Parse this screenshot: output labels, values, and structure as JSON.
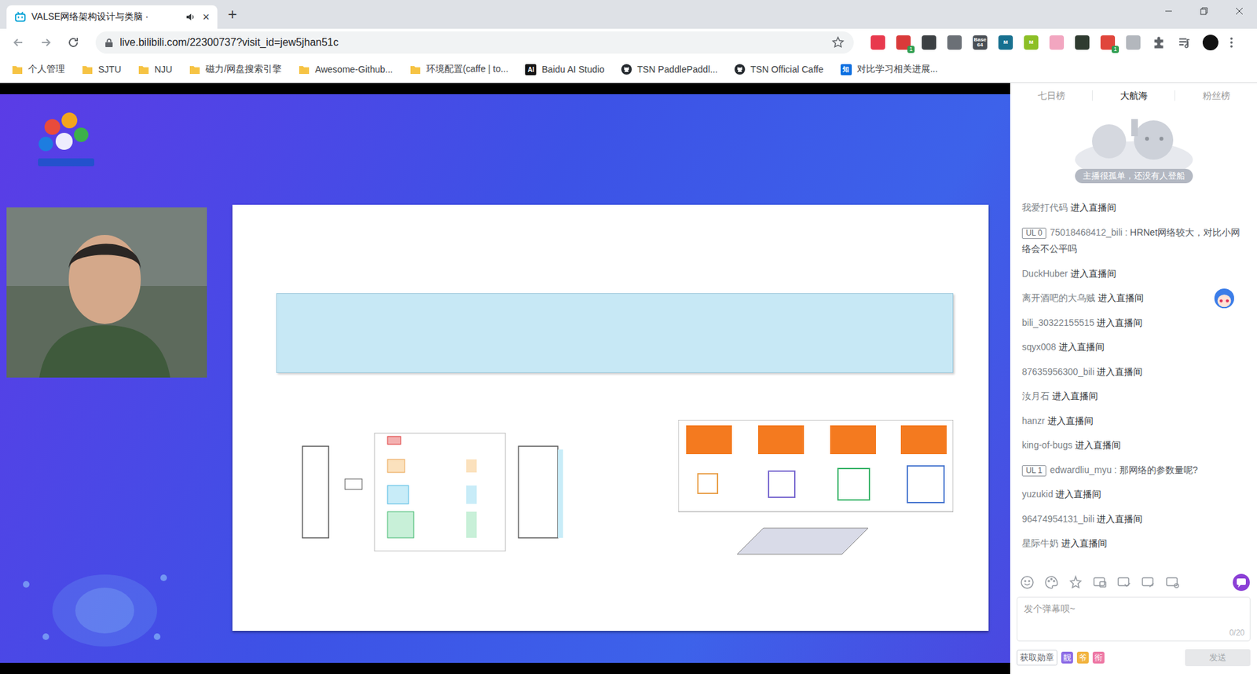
{
  "browser": {
    "tab": {
      "title": "VALSE网络架构设计与类脑 ·",
      "selected": true,
      "audio": true,
      "close": "×"
    },
    "new_tab": "+",
    "url": "live.bilibili.com/22300737?visit_id=jew5jhan51c",
    "extensions": [
      {
        "label": "",
        "badge": "",
        "color": "#e8394d"
      },
      {
        "label": "",
        "badge": "1",
        "color": "#d93a3a"
      },
      {
        "label": "",
        "badge": "",
        "color": "#3c4043"
      },
      {
        "label": "",
        "badge": "",
        "color": "#6b7076"
      },
      {
        "label": "Base 64",
        "badge": "",
        "color": "#4a4f55"
      },
      {
        "label": "M",
        "badge": "",
        "color": "#17708f"
      },
      {
        "label": "M",
        "badge": "",
        "color": "#8cbf26"
      },
      {
        "label": "",
        "badge": "",
        "color": "#f2a6c0"
      },
      {
        "label": "",
        "badge": "",
        "color": "#2f3b30"
      },
      {
        "label": "",
        "badge": "1",
        "color": "#e0463c"
      },
      {
        "label": "",
        "badge": "",
        "color": "#b3b7bd"
      }
    ],
    "bookmarks": [
      {
        "label": "个人管理",
        "kind": "folder",
        "icon_text": ""
      },
      {
        "label": "SJTU",
        "kind": "folder",
        "icon_text": ""
      },
      {
        "label": "NJU",
        "kind": "folder",
        "icon_text": ""
      },
      {
        "label": "磁力/网盘搜索引擎",
        "kind": "folder",
        "icon_text": ""
      },
      {
        "label": "Awesome-Github...",
        "kind": "folder",
        "icon_text": ""
      },
      {
        "label": "环境配置(caffe | to...",
        "kind": "folder",
        "icon_text": ""
      },
      {
        "label": "Baidu AI Studio",
        "kind": "badge",
        "icon_text": "AI"
      },
      {
        "label": "TSN PaddlePaddl...",
        "kind": "github",
        "icon_text": ""
      },
      {
        "label": "TSN Official Caffe",
        "kind": "github",
        "icon_text": ""
      },
      {
        "label": "对比学习相关进展...",
        "kind": "zhihu",
        "icon_text": "知"
      }
    ]
  },
  "sidebar": {
    "rank_tabs": [
      {
        "label": "七日榜",
        "selected": false
      },
      {
        "label": "大航海",
        "selected": true
      },
      {
        "label": "粉丝榜",
        "selected": false
      }
    ],
    "empty_banner": "主播很孤单，还没有人登船",
    "chat": [
      {
        "kind": "enter",
        "user": "我爱打代码",
        "text": "进入直播间"
      },
      {
        "kind": "comment",
        "badge": "UL 0",
        "user": "75018468412_bili",
        "sep": ":",
        "text": "HRNet网络较大，对比小网络会不公平吗"
      },
      {
        "kind": "enter",
        "user": "DuckHuber",
        "text": "进入直播间"
      },
      {
        "kind": "enter",
        "user": "离开酒吧的大乌贼",
        "text": "进入直播间",
        "mascot": true
      },
      {
        "kind": "enter",
        "user": "bili_30322155515",
        "text": "进入直播间"
      },
      {
        "kind": "enter",
        "user": "sqyx008",
        "text": "进入直播间"
      },
      {
        "kind": "enter",
        "user": "87635956300_bili",
        "text": "进入直播间"
      },
      {
        "kind": "enter",
        "user": "汝月石",
        "text": "进入直播间"
      },
      {
        "kind": "enter",
        "user": "hanzr",
        "text": "进入直播间"
      },
      {
        "kind": "enter",
        "user": "king-of-bugs",
        "text": "进入直播间"
      },
      {
        "kind": "comment",
        "badge": "UL 1",
        "user": "edwardliu_myu",
        "sep": ":",
        "text": "那网络的参数量呢?"
      },
      {
        "kind": "enter",
        "user": "yuzukid",
        "text": "进入直播间"
      },
      {
        "kind": "enter",
        "user": "96474954131_bili",
        "text": "进入直播间"
      },
      {
        "kind": "enter",
        "user": "星际牛奶",
        "text": "进入直播间"
      }
    ],
    "input": {
      "placeholder": "发个弹幕呗~",
      "counter": "0/20"
    },
    "medal_button": "获取勋章",
    "privileges": [
      {
        "label": "靓",
        "color": "#8d6ce6"
      },
      {
        "label": "爷",
        "color": "#f2b441"
      },
      {
        "label": "衔",
        "color": "#ee7aa6"
      }
    ],
    "send_button": {
      "label": "发送",
      "disabled": true
    }
  }
}
